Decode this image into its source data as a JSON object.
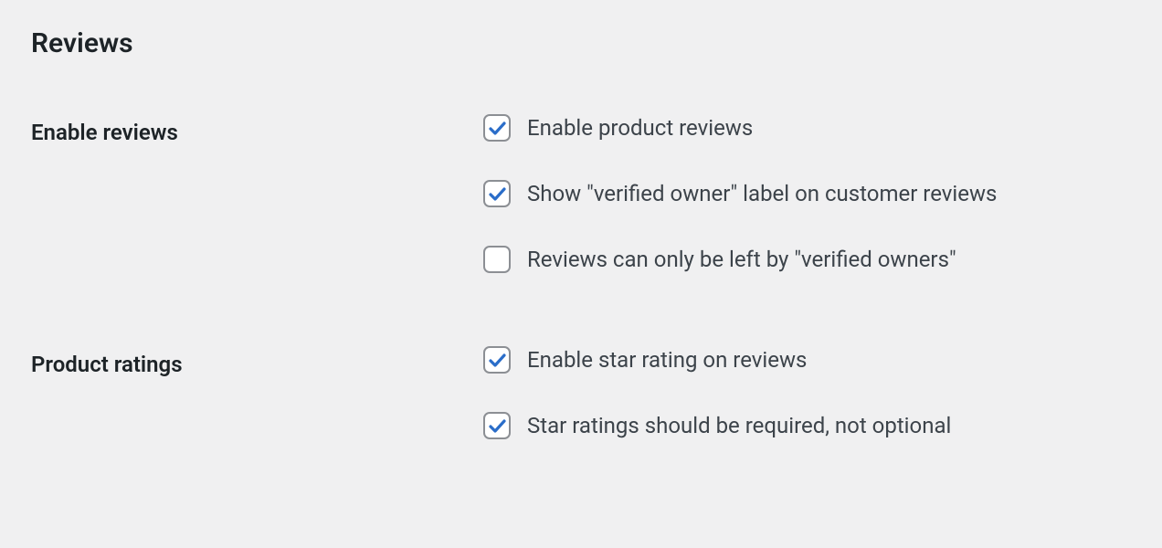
{
  "section_title": "Reviews",
  "rows": [
    {
      "label": "Enable reviews",
      "options": [
        {
          "label": "Enable product reviews",
          "checked": true
        },
        {
          "label": "Show \"verified owner\" label on customer reviews",
          "checked": true
        },
        {
          "label": "Reviews can only be left by \"verified owners\"",
          "checked": false
        }
      ]
    },
    {
      "label": "Product ratings",
      "options": [
        {
          "label": "Enable star rating on reviews",
          "checked": true
        },
        {
          "label": "Star ratings should be required, not optional",
          "checked": true
        }
      ]
    }
  ]
}
